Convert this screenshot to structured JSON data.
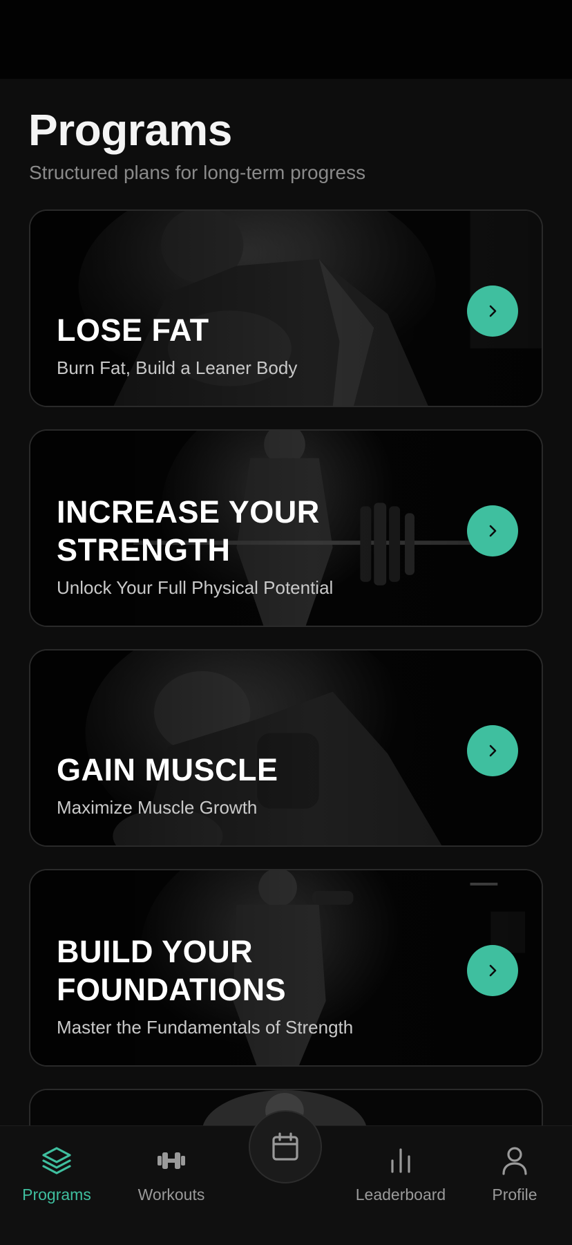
{
  "header": {
    "title": "Programs",
    "subtitle": "Structured plans for long-term progress"
  },
  "programs": [
    {
      "title": "LOSE FAT",
      "subtitle": "Burn Fat, Build a Leaner Body",
      "image_icon": "athlete-pushup-photo"
    },
    {
      "title": "INCREASE YOUR STRENGTH",
      "subtitle": "Unlock Your Full Physical Potential",
      "image_icon": "athlete-barbell-photo"
    },
    {
      "title": "GAIN MUSCLE",
      "subtitle": "Maximize Muscle Growth",
      "image_icon": "athlete-curl-photo"
    },
    {
      "title": "BUILD YOUR FOUNDATIONS",
      "subtitle": "Master the Fundamentals of Strength",
      "image_icon": "athlete-dumbbell-photo"
    }
  ],
  "tabbar": {
    "tabs": [
      {
        "label": "Programs",
        "icon": "layers-icon",
        "active": true
      },
      {
        "label": "Workouts",
        "icon": "dumbbell-icon",
        "active": false
      },
      {
        "label": "Leaderboard",
        "icon": "bar-chart-icon",
        "active": false
      },
      {
        "label": "Profile",
        "icon": "user-icon",
        "active": false
      }
    ],
    "center_icon": "calendar-icon"
  },
  "colors": {
    "accent": "#3fbf9f",
    "background": "#0d0d0d",
    "card_border": "#2a2a2a",
    "muted_text": "#8a8a8a"
  }
}
